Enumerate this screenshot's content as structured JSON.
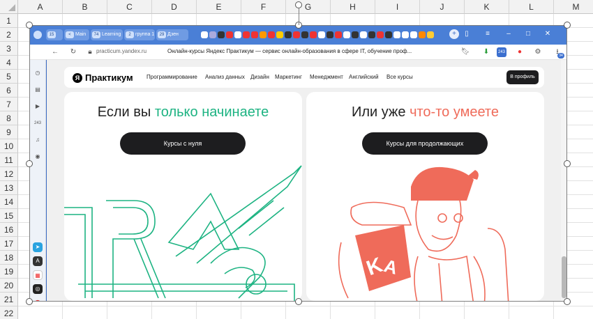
{
  "sheet": {
    "columns": [
      "A",
      "B",
      "C",
      "D",
      "E",
      "F",
      "G",
      "H",
      "I",
      "J",
      "K",
      "L",
      "M"
    ],
    "rows": [
      "1",
      "2",
      "3",
      "4",
      "5",
      "6",
      "7",
      "8",
      "9",
      "10",
      "11",
      "12",
      "13",
      "14",
      "15",
      "16",
      "17",
      "18",
      "19",
      "20",
      "21",
      "22"
    ]
  },
  "browser": {
    "tabs": [
      {
        "count": "15",
        "label": ""
      },
      {
        "count": "<",
        "label": "Main"
      },
      {
        "count": "74",
        "label": "Learning"
      },
      {
        "count": "2",
        "label": "группа 1"
      },
      {
        "count": "29",
        "label": "Дзен"
      }
    ],
    "address": {
      "url": "practicum.yandex.ru",
      "title": "Онлайн-курсы Яндекс Практикум — сервис онлайн-образования в сфере IT, обучение проф..."
    },
    "download_badge": "34"
  },
  "site": {
    "logo": "Практикум",
    "logo_mark": "Я",
    "nav": [
      "Программирование",
      "Анализ данных",
      "Дизайн",
      "Маркетинг",
      "Менеджмент",
      "Английский",
      "Все курсы"
    ],
    "profile_button": "В профиль",
    "left_card": {
      "title_prefix": "Если вы ",
      "title_highlight": "только начинаете",
      "button": "Курсы с нуля"
    },
    "right_card": {
      "title_prefix": "Или уже ",
      "title_highlight": "что-то умеете",
      "button": "Курсы для продолжающих"
    }
  },
  "colors": {
    "green_accent": "#1db382",
    "coral_accent": "#ef6b5a",
    "browser_blue": "#4a7fd6"
  }
}
